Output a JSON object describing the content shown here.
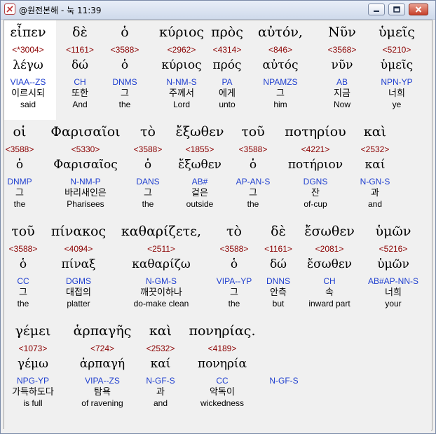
{
  "window": {
    "title": "@원전본해 - 눅 11:39",
    "controls": {
      "minimize": "minimize",
      "maximize": "maximize",
      "close": "close"
    }
  },
  "colors": {
    "strong": "#8b0000",
    "parse": "#1f3fcf",
    "text": "#000000",
    "selection": "#ffffff"
  },
  "lines": [
    {
      "words": [
        {
          "greek": "εἶπεν",
          "strong": "<*3004>",
          "lemma": "λέγω",
          "parse": "VIAA--ZS",
          "korean": "이르시되",
          "english": "said"
        },
        {
          "greek": "δὲ",
          "strong": "<1161>",
          "lemma": "δώ",
          "parse": "CH",
          "korean": "또한",
          "english": "And"
        },
        {
          "greek": "ὁ",
          "strong": "<3588>",
          "lemma": "ὁ",
          "parse": "DNMS",
          "korean": "그",
          "english": "the"
        },
        {
          "greek": "κύριος",
          "strong": "<2962>",
          "lemma": "κύριος",
          "parse": "N-NM-S",
          "korean": "주께서",
          "english": "Lord"
        },
        {
          "greek": "πρὸς",
          "strong": "<4314>",
          "lemma": "πρός",
          "parse": "PA",
          "korean": "에게",
          "english": "unto"
        },
        {
          "greek": "αὐτόν,",
          "strong": "<846>",
          "lemma": "αὐτός",
          "parse": "NPAMZS",
          "korean": "그",
          "english": "him"
        },
        {
          "greek": "Νῦν",
          "strong": "<3568>",
          "lemma": "νῦν",
          "parse": "AB",
          "korean": "지금",
          "english": "Now"
        },
        {
          "greek": "ὑμεῖς",
          "strong": "<5210>",
          "lemma": "ὑμεῖς",
          "parse": "NPN-YP",
          "korean": "너희",
          "english": "ye"
        }
      ]
    },
    {
      "words": [
        {
          "greek": "οἱ",
          "strong": "<3588>",
          "lemma": "ὁ",
          "parse": "DNMP",
          "korean": "그",
          "english": "the"
        },
        {
          "greek": "Φαρισαῖοι",
          "strong": "<5330>",
          "lemma": "Φαρισαῖος",
          "parse": "N-NM-P",
          "korean": "바리새인은",
          "english": "Pharisees"
        },
        {
          "greek": "τὸ",
          "strong": "<3588>",
          "lemma": "ὁ",
          "parse": "DANS",
          "korean": "그",
          "english": "the"
        },
        {
          "greek": "ἔξωθεν",
          "strong": "<1855>",
          "lemma": "ἔξωθεν",
          "parse": "AB#",
          "korean": "겉은",
          "english": "outside"
        },
        {
          "greek": "τοῦ",
          "strong": "<3588>",
          "lemma": "ὁ",
          "parse": "AP-AN-S",
          "korean": "그",
          "english": "the"
        },
        {
          "greek": "ποτηρίου",
          "strong": "<4221>",
          "lemma": "ποτήριον",
          "parse": "DGNS",
          "korean": "잔",
          "english": "of-cup"
        },
        {
          "greek": "καὶ",
          "strong": "<2532>",
          "lemma": "καί",
          "parse": "N-GN-S",
          "korean": "과",
          "english": "and"
        }
      ]
    },
    {
      "words": [
        {
          "greek": "τοῦ",
          "strong": "<3588>",
          "lemma": "ὁ",
          "parse": "CC",
          "korean": "그",
          "english": "the"
        },
        {
          "greek": "πίνακος",
          "strong": "<4094>",
          "lemma": "πίναξ",
          "parse": "DGMS",
          "korean": "대접의",
          "english": "platter"
        },
        {
          "greek": "καθαρίζετε,",
          "strong": "<2511>",
          "lemma": "καθαρίζω",
          "parse": "N-GM-S",
          "korean": "깨끗이하나",
          "english": "do-make clean"
        },
        {
          "greek": "τὸ",
          "strong": "<3588>",
          "lemma": "ὁ",
          "parse": "VIPA--YP",
          "korean": "그",
          "english": "the"
        },
        {
          "greek": "δὲ",
          "strong": "<1161>",
          "lemma": "δώ",
          "parse": "DNNS",
          "korean": "안측",
          "english": "but"
        },
        {
          "greek": "ἔσωθεν",
          "strong": "<2081>",
          "lemma": "ἔσωθεν",
          "parse": "CH",
          "korean": "속",
          "english": "inward part"
        },
        {
          "greek": "ὑμῶν",
          "strong": "<5216>",
          "lemma": "ὑμῶν",
          "parse": "AB#AP-NN-S",
          "korean": "너희",
          "english": "your"
        }
      ]
    },
    {
      "words": [
        {
          "greek": "γέμει",
          "strong": "<1073>",
          "lemma": "γέμω",
          "parse": "NPG-YP",
          "korean": "가득하도다",
          "english": "is full"
        },
        {
          "greek": "ἁρπαγῆς",
          "strong": "<724>",
          "lemma": "ἁρπαγή",
          "parse": "VIPA--ZS",
          "korean": "탐욕",
          "english": "of ravening"
        },
        {
          "greek": "καὶ",
          "strong": "<2532>",
          "lemma": "καί",
          "parse": "N-GF-S",
          "korean": "과",
          "english": "and"
        },
        {
          "greek": "πονηρίας.",
          "strong": "<4189>",
          "lemma": "πονηρία",
          "parse": "CC",
          "korean": "악독이",
          "english": "wickedness"
        },
        {
          "greek": "",
          "strong": "",
          "lemma": "",
          "parse": "N-GF-S",
          "korean": "",
          "english": ""
        }
      ]
    }
  ]
}
